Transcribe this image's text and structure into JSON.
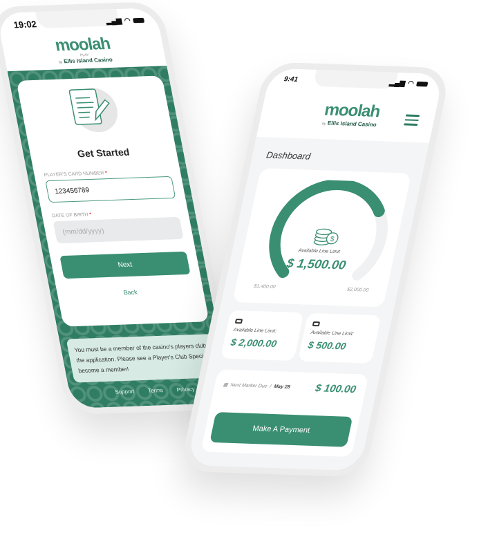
{
  "colors": {
    "brand": "#3a8f72",
    "dark_green": "#2f7d63"
  },
  "brand": {
    "name": "moolah",
    "sub": "PLAY",
    "by": "by",
    "casino": "Ellis Island Casino"
  },
  "left_phone": {
    "time": "19:02",
    "title": "Get Started",
    "card_label": "PLAYER'S CARD NUMBER",
    "card_value": "123456789",
    "dob_label": "DATE OF BIRTH",
    "required": "*",
    "dob_placeholder": "(mm/dd/yyyy)",
    "next": "Next",
    "back": "Back",
    "notice": "You must be a member of the casino's players club to start the application. Please see a Player's Club Specialist to become a member!",
    "footer": [
      "Support",
      "Terms",
      "Privacy"
    ]
  },
  "right_phone": {
    "time": "9:41",
    "title": "Dashboard",
    "gauge": {
      "label": "Available Line Limit",
      "value": "$ 1,500.00",
      "min": "$1,400.00",
      "max": "$2,000.00",
      "progress": 0.72
    },
    "cards": [
      {
        "label": "Available Line Limit:",
        "value": "$ 2,000.00"
      },
      {
        "label": "Available Line Limit:",
        "value": "$ 500.00"
      }
    ],
    "next_marker": {
      "label": "Next Marker Due",
      "sep": "/",
      "date": "May 28",
      "amount": "$ 100.00"
    },
    "pay_button": "Make A Payment"
  }
}
